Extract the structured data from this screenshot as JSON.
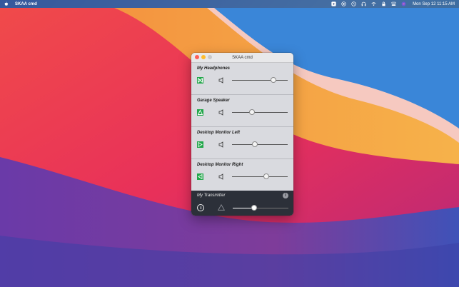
{
  "menubar": {
    "app_name": "SKAA cmd",
    "clock": "Mon Sep 12  11:15 AM",
    "status_icons": [
      "skaa-icon",
      "record-icon",
      "time-machine-icon",
      "headphones-icon",
      "wifi-icon",
      "lock-icon",
      "control-center-icon",
      "siri-icon"
    ]
  },
  "window": {
    "title": "SKAA cmd"
  },
  "devices": [
    {
      "name": "My Headphones",
      "icon": "headphones-device-icon",
      "volume": 0.74
    },
    {
      "name": "Garage Speaker",
      "icon": "speaker-device-icon",
      "volume": 0.36
    },
    {
      "name": "Desktop Monitor Left",
      "icon": "monitor-left-device-icon",
      "volume": 0.41
    },
    {
      "name": "Desktop Monitor Right",
      "icon": "monitor-right-device-icon",
      "volume": 0.61
    }
  ],
  "transmitter": {
    "name": "My Transmitter",
    "info_label": "i",
    "level": 0.39
  },
  "colors": {
    "device_icon_green": "#22a74a",
    "transmitter_bg": "#2c3039"
  }
}
